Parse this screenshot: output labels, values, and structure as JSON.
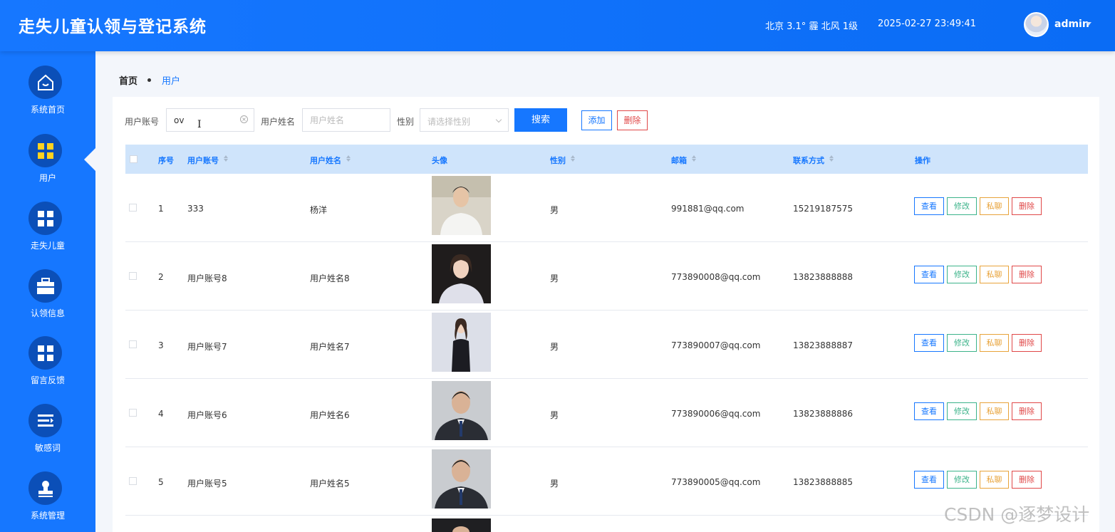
{
  "header": {
    "title": "走失儿童认领与登记系统",
    "weather": "北京  3.1°  霾  北风  1级",
    "datetime": "2025-02-27 23:49:41",
    "username": "admin",
    "brand_color": "#1677ff"
  },
  "sidebar": {
    "items": [
      {
        "label": "系统首页",
        "icon": "home-icon"
      },
      {
        "label": "用户",
        "icon": "grid-icon",
        "active": true
      },
      {
        "label": "走失儿童",
        "icon": "grid-icon"
      },
      {
        "label": "认领信息",
        "icon": "briefcase-icon"
      },
      {
        "label": "留言反馈",
        "icon": "grid-icon"
      },
      {
        "label": "敏感词",
        "icon": "list-icon"
      },
      {
        "label": "系统管理",
        "icon": "stamp-icon"
      }
    ]
  },
  "breadcrumb": {
    "home": "首页",
    "current": "用户"
  },
  "search": {
    "account_label": "用户账号",
    "account_value": "ov",
    "name_label": "用户姓名",
    "name_placeholder": "用户姓名",
    "gender_label": "性别",
    "gender_placeholder": "请选择性别",
    "search_button": "搜索",
    "add_button": "添加",
    "delete_button": "删除"
  },
  "table": {
    "columns": [
      "序号",
      "用户账号",
      "用户姓名",
      "头像",
      "性别",
      "邮箱",
      "联系方式",
      "操作"
    ],
    "actions": {
      "view": "查看",
      "edit": "修改",
      "chat": "私聊",
      "delete": "删除"
    },
    "rows": [
      {
        "index": "1",
        "account": "333",
        "name": "杨洋",
        "gender": "男",
        "email": "991881@qq.com",
        "phone": "15219187575"
      },
      {
        "index": "2",
        "account": "用户账号8",
        "name": "用户姓名8",
        "gender": "男",
        "email": "773890008@qq.com",
        "phone": "13823888888"
      },
      {
        "index": "3",
        "account": "用户账号7",
        "name": "用户姓名7",
        "gender": "男",
        "email": "773890007@qq.com",
        "phone": "13823888887"
      },
      {
        "index": "4",
        "account": "用户账号6",
        "name": "用户姓名6",
        "gender": "男",
        "email": "773890006@qq.com",
        "phone": "13823888886"
      },
      {
        "index": "5",
        "account": "用户账号5",
        "name": "用户姓名5",
        "gender": "男",
        "email": "773890005@qq.com",
        "phone": "13823888885"
      }
    ]
  },
  "watermark": "CSDN @逐梦设计"
}
